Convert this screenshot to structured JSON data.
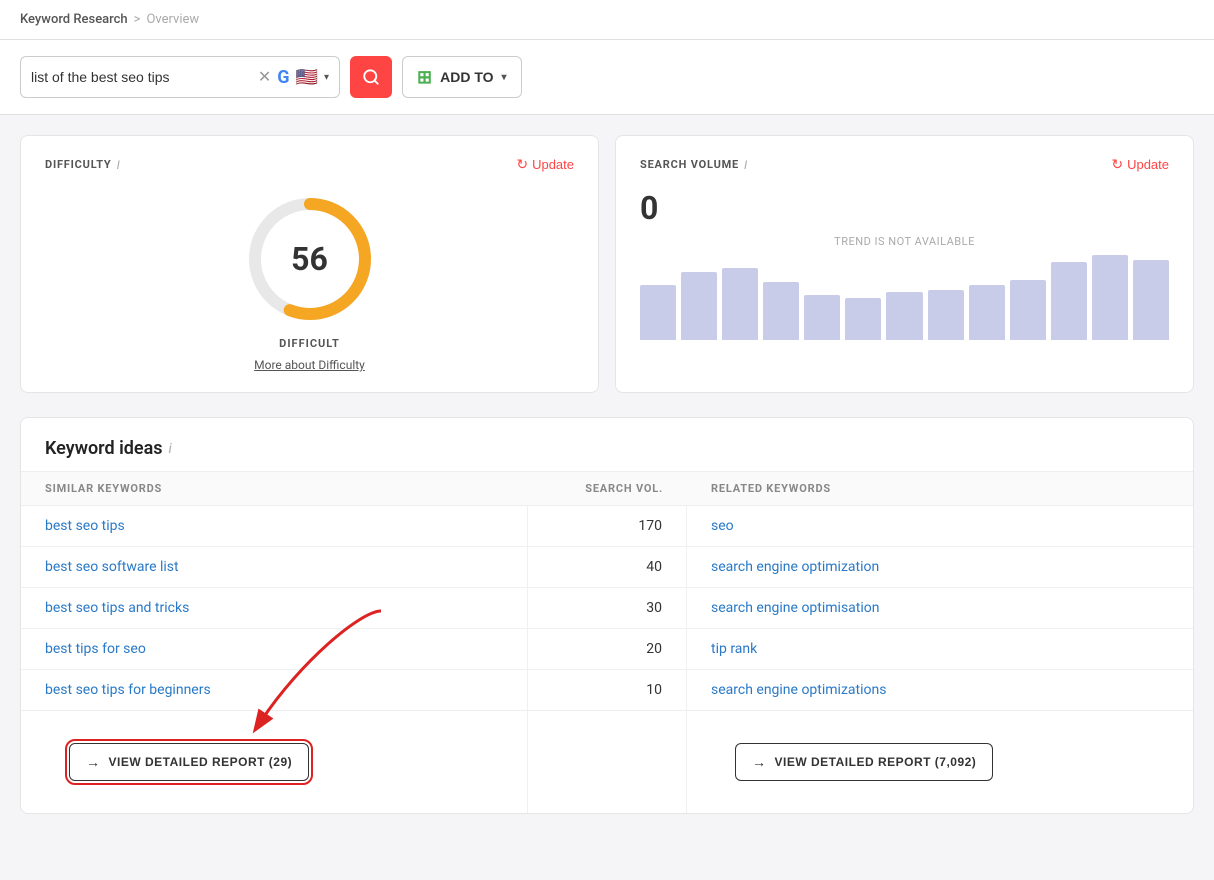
{
  "breadcrumb": {
    "parent": "Keyword Research",
    "separator": ">",
    "current": "Overview"
  },
  "search": {
    "query": "list of the best seo tips",
    "placeholder": "list of the best seo tips",
    "engine_flag": "🇺🇸",
    "search_icon": "🔍",
    "add_to_label": "ADD TO"
  },
  "difficulty": {
    "title": "DIFFICULTY",
    "info": "i",
    "update_label": "Update",
    "value": 56,
    "label": "DIFFICULT",
    "more_link": "More about Difficulty",
    "gauge_bg_color": "#e0e0e0",
    "gauge_fill_color": "#f5a623",
    "gauge_radius": 60,
    "gauge_stroke": 10,
    "gauge_percent": 0.56
  },
  "search_volume": {
    "title": "SEARCH VOLUME",
    "info": "i",
    "update_label": "Update",
    "value": "0",
    "trend_label": "TREND IS NOT AVAILABLE",
    "bars": [
      55,
      68,
      72,
      58,
      45,
      42,
      48,
      50,
      55,
      60,
      78,
      85,
      80
    ]
  },
  "keyword_ideas": {
    "title": "Keyword ideas",
    "info": "i",
    "columns": {
      "similar": "SIMILAR KEYWORDS",
      "search_vol": "SEARCH VOL.",
      "related": "RELATED KEYWORDS"
    },
    "rows": [
      {
        "similar": "best seo tips",
        "vol": "170",
        "related": "seo"
      },
      {
        "similar": "best seo software list",
        "vol": "40",
        "related": "search engine optimization"
      },
      {
        "similar": "best seo tips and tricks",
        "vol": "30",
        "related": "search engine optimisation"
      },
      {
        "similar": "best tips for seo",
        "vol": "20",
        "related": "tip rank"
      },
      {
        "similar": "best seo tips for beginners",
        "vol": "10",
        "related": "search engine optimizations"
      }
    ],
    "view_similar_label": "VIEW DETAILED REPORT (29)",
    "view_related_label": "VIEW DETAILED REPORT (7,092)"
  }
}
